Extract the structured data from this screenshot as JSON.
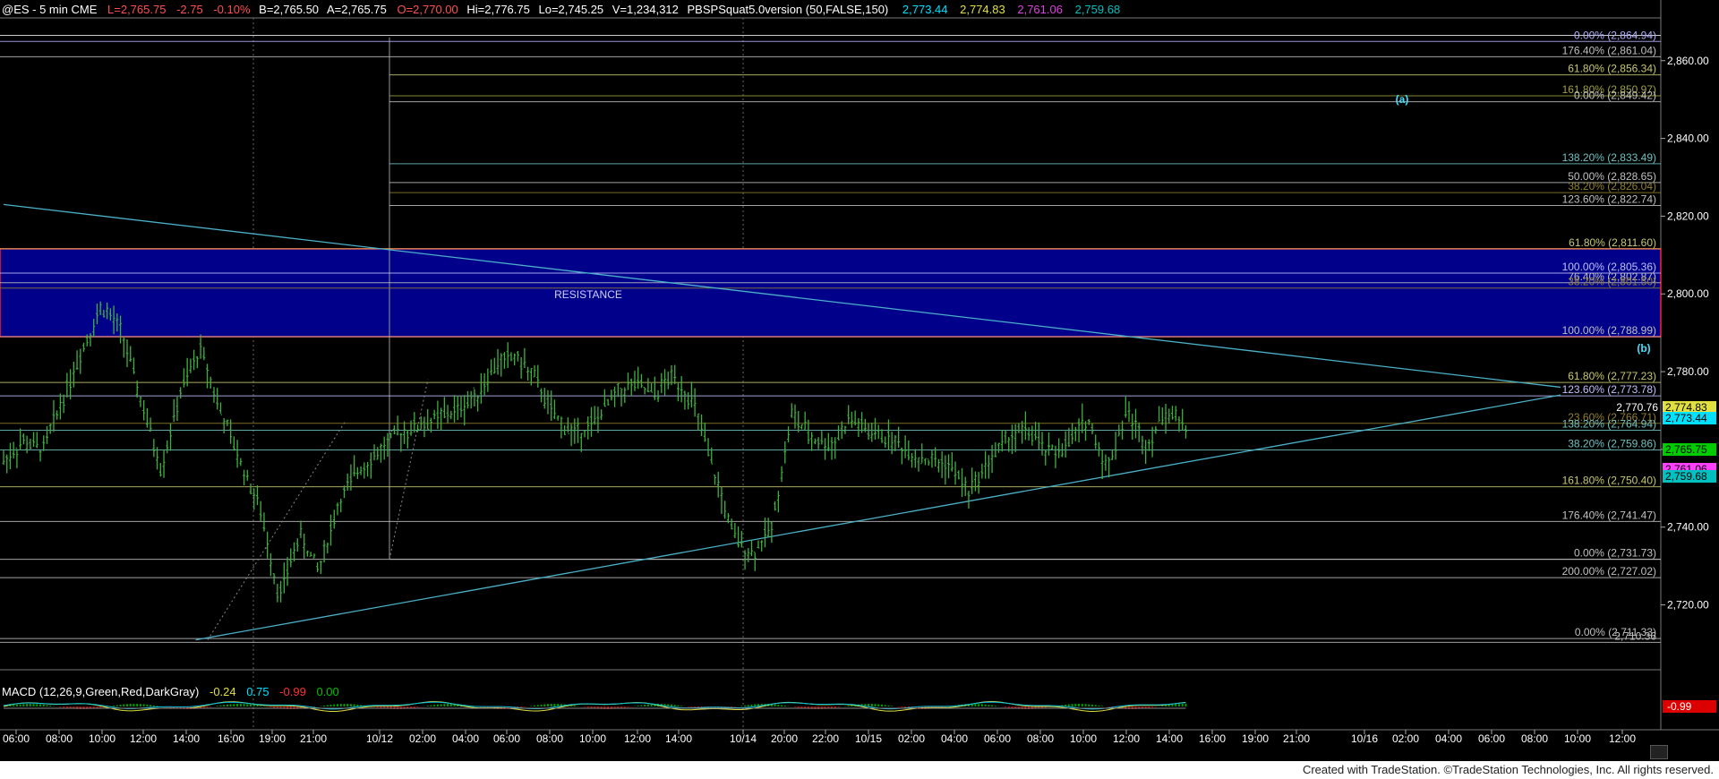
{
  "header": {
    "symbol": "@ES - 5 min  CME",
    "last": "L=2,765.75",
    "change": "-2.75",
    "pct": "-0.10%",
    "bid": "B=2,765.50",
    "ask": "A=2,765.75",
    "open": "O=2,770.00",
    "high": "Hi=2,776.75",
    "low": "Lo=2,745.25",
    "volume": "V=1,234,312",
    "indicator": "PBSPSquat5.0version (50,FALSE,150)",
    "ind_values": [
      {
        "text": "2,773.44",
        "color": "#00e0ff"
      },
      {
        "text": "2,774.83",
        "color": "#e0e040"
      },
      {
        "text": "2,761.06",
        "color": "#e040e0"
      },
      {
        "text": "2,759.68",
        "color": "#00c0c0"
      }
    ]
  },
  "macd": {
    "label": "MACD (12,26,9,Green,Red,DarkGray)",
    "v1": "-0.24",
    "v2": "0.75",
    "v3": "-0.99",
    "v4": "0.00",
    "axis_label": "-0.99"
  },
  "footer": {
    "credit": "Created with TradeStation. ©TradeStation Technologies, Inc. All rights reserved."
  },
  "colors": {
    "price_bars": "#3fb03f",
    "resistance": "#00008b",
    "trendline": "#4ab0c8",
    "grid": "#555555"
  },
  "chart_data": {
    "type": "bar",
    "title": "@ES - 5 min CME",
    "ylim": [
      2704,
      2871
    ],
    "y_ticks": [
      "2,720.00",
      "2,740.00",
      "2,760.00",
      "2,780.00",
      "2,800.00",
      "2,820.00",
      "2,840.00",
      "2,860.00"
    ],
    "x_ticks": [
      "06:00",
      "08:00",
      "10:00",
      "12:00",
      "14:00",
      "16:00",
      "19:00",
      "21:00",
      "10/12",
      "02:00",
      "04:00",
      "06:00",
      "08:00",
      "10:00",
      "12:00",
      "14:00",
      "10/14",
      "20:00",
      "22:00",
      "10/15",
      "02:00",
      "04:00",
      "06:00",
      "08:00",
      "10:00",
      "12:00",
      "14:00",
      "16:00",
      "19:00",
      "21:00",
      "10/16",
      "02:00",
      "04:00",
      "06:00",
      "08:00",
      "10:00",
      "12:00"
    ],
    "resistance_zone": {
      "low": 2788.99,
      "high": 2811.6,
      "label": "RESISTANCE"
    },
    "fib_levels": [
      {
        "price": 2864.94,
        "label": "0.00% (2,864.94)",
        "color": "#b0b0ff"
      },
      {
        "price": 2861.0,
        "label": "176.40% (2,861.04)",
        "color": "#c0c0c0"
      },
      {
        "price": 2856.34,
        "label": "61.80% (2,856.34)",
        "color": "#c8c870"
      },
      {
        "price": 2850.97,
        "label": "161.80% (2,850.97)",
        "color": "#a0a040"
      },
      {
        "price": 2849.42,
        "label": "0.00% (2,849.42)",
        "color": "#c0c0c0"
      },
      {
        "price": 2833.49,
        "label": "138.20% (2,833.49)",
        "color": "#70c0c0"
      },
      {
        "price": 2828.65,
        "label": "50.00% (2,828.65)",
        "color": "#c0c0c0"
      },
      {
        "price": 2826.04,
        "label": "38.20% (2,826.04)",
        "color": "#908030"
      },
      {
        "price": 2822.74,
        "label": "123.60% (2,822.74)",
        "color": "#c0c0c0"
      },
      {
        "price": 2811.6,
        "label": "61.80% (2,811.60)",
        "color": "#c8c870"
      },
      {
        "price": 2805.36,
        "label": "100.00% (2,805.36)",
        "color": "#c0c0ff"
      },
      {
        "price": 2802.87,
        "label": "76.40% (2,802.87)",
        "color": "#c0c0c0"
      },
      {
        "price": 2801.5,
        "label": "38.20% (2,801.50)",
        "color": "#908030"
      },
      {
        "price": 2788.99,
        "label": "100.00% (2,788.99)",
        "color": "#c0c0c0"
      },
      {
        "price": 2777.23,
        "label": "61.80% (2,777.23)",
        "color": "#c8c870"
      },
      {
        "price": 2773.78,
        "label": "123.60% (2,773.78)",
        "color": "#c0c0ff"
      },
      {
        "price": 2766.71,
        "label": "23.60% (2,766.71)",
        "color": "#908030"
      },
      {
        "price": 2764.94,
        "label": "138.20% (2,764.94)",
        "color": "#70c0c0"
      },
      {
        "price": 2759.86,
        "label": "38.20% (2,759.86)",
        "color": "#70c0c0"
      },
      {
        "price": 2750.4,
        "label": "161.80% (2,750.40)",
        "color": "#c8c870"
      },
      {
        "price": 2741.47,
        "label": "176.40% (2,741.47)",
        "color": "#c0c0c0"
      },
      {
        "price": 2731.73,
        "label": "0.00% (2,731.73)",
        "color": "#c0c0c0"
      },
      {
        "price": 2727.02,
        "label": "200.00% (2,727.02)",
        "color": "#c0c0c0"
      },
      {
        "price": 2711.33,
        "label": "0.00% (2,711.33)",
        "color": "#c0c0c0"
      },
      {
        "price": 2710.36,
        "label": "2,710.36",
        "color": "#c0c0c0"
      }
    ],
    "price_marker": {
      "price": 2770.76,
      "label": "2,770.76"
    },
    "axis_boxes": [
      {
        "price": 2774.5,
        "label": "2,774.83",
        "color": "#e0e040"
      },
      {
        "price": 2773.44,
        "label": "2,773.44",
        "color": "#00e0ff"
      },
      {
        "price": 2765.75,
        "label": "2,765.75",
        "color": "#00cc00"
      },
      {
        "price": 2761.06,
        "label": "2,761.06",
        "color": "#ff40ff"
      },
      {
        "price": 2759.68,
        "label": "2,759.68",
        "color": "#00c0c0"
      }
    ],
    "wave_labels": [
      {
        "text": "(a)",
        "price": 2850.0
      },
      {
        "text": "(b)",
        "price": 2786.0
      }
    ],
    "trendlines": [
      {
        "name": "upper",
        "from": {
          "bar": 0,
          "price": 2823
        },
        "to": {
          "bar": 470,
          "price": 2776
        }
      },
      {
        "name": "lower",
        "from": {
          "bar": 58,
          "price": 2711
        },
        "to": {
          "bar": 470,
          "price": 2774
        }
      }
    ],
    "price_path": [
      2757,
      2762,
      2760,
      2773,
      2786,
      2797,
      2790,
      2772,
      2755,
      2775,
      2786,
      2770,
      2757,
      2745,
      2722,
      2738,
      2729,
      2746,
      2755,
      2759,
      2764,
      2766,
      2768,
      2770,
      2774,
      2782,
      2784,
      2778,
      2768,
      2764,
      2767,
      2774,
      2777,
      2774,
      2779,
      2772,
      2755,
      2738,
      2733,
      2740,
      2769,
      2763,
      2761,
      2768,
      2764,
      2763,
      2759,
      2757,
      2756,
      2749,
      2757,
      2763,
      2765,
      2759,
      2761,
      2768,
      2755,
      2770,
      2761,
      2770,
      2766
    ]
  }
}
